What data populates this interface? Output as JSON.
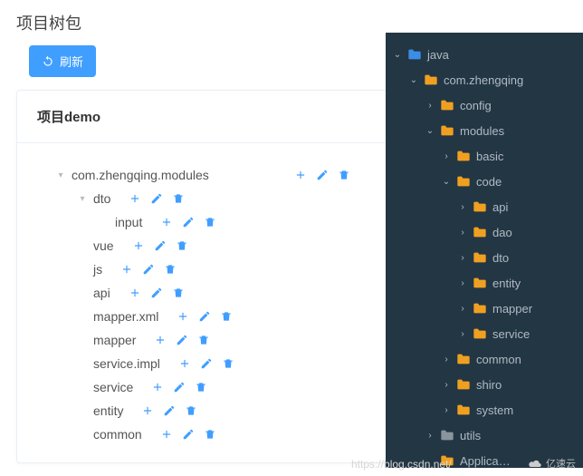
{
  "header": {
    "title": "项目树包",
    "refresh_label": "刷新"
  },
  "card": {
    "title": "项目demo"
  },
  "left_tree": {
    "nodes": [
      {
        "label": "com.zhengqing.modules",
        "indent": 0,
        "expand": "down",
        "gap": 94
      },
      {
        "label": "dto",
        "indent": 24,
        "expand": "down",
        "gap": 20
      },
      {
        "label": "input",
        "indent": 48,
        "expand": "",
        "gap": 20
      },
      {
        "label": "vue",
        "indent": 24,
        "expand": "",
        "gap": 20
      },
      {
        "label": "js",
        "indent": 24,
        "expand": "",
        "gap": 20
      },
      {
        "label": "api",
        "indent": 24,
        "expand": "",
        "gap": 20
      },
      {
        "label": "mapper.xml",
        "indent": 24,
        "expand": "",
        "gap": 20
      },
      {
        "label": "mapper",
        "indent": 24,
        "expand": "",
        "gap": 20
      },
      {
        "label": "service.impl",
        "indent": 24,
        "expand": "",
        "gap": 20
      },
      {
        "label": "service",
        "indent": 24,
        "expand": "",
        "gap": 20
      },
      {
        "label": "entity",
        "indent": 24,
        "expand": "",
        "gap": 20
      },
      {
        "label": "common",
        "indent": 24,
        "expand": "",
        "gap": 20
      }
    ]
  },
  "sidebar": {
    "items": [
      {
        "label": "java",
        "indent": 8,
        "chevron": "down",
        "folder": "blue"
      },
      {
        "label": "com.zhengqing",
        "indent": 26,
        "chevron": "down",
        "folder": "orange"
      },
      {
        "label": "config",
        "indent": 44,
        "chevron": "right",
        "folder": "orange"
      },
      {
        "label": "modules",
        "indent": 44,
        "chevron": "down",
        "folder": "orange"
      },
      {
        "label": "basic",
        "indent": 62,
        "chevron": "right",
        "folder": "orange"
      },
      {
        "label": "code",
        "indent": 62,
        "chevron": "down",
        "folder": "orange"
      },
      {
        "label": "api",
        "indent": 80,
        "chevron": "right",
        "folder": "orange"
      },
      {
        "label": "dao",
        "indent": 80,
        "chevron": "right",
        "folder": "orange"
      },
      {
        "label": "dto",
        "indent": 80,
        "chevron": "right",
        "folder": "orange"
      },
      {
        "label": "entity",
        "indent": 80,
        "chevron": "right",
        "folder": "orange"
      },
      {
        "label": "mapper",
        "indent": 80,
        "chevron": "right",
        "folder": "orange"
      },
      {
        "label": "service",
        "indent": 80,
        "chevron": "right",
        "folder": "orange"
      },
      {
        "label": "common",
        "indent": 62,
        "chevron": "right",
        "folder": "orange"
      },
      {
        "label": "shiro",
        "indent": 62,
        "chevron": "right",
        "folder": "orange"
      },
      {
        "label": "system",
        "indent": 62,
        "chevron": "right",
        "folder": "orange"
      },
      {
        "label": "utils",
        "indent": 44,
        "chevron": "right",
        "folder": "grey"
      },
      {
        "label": "Applica…",
        "indent": 44,
        "chevron": "",
        "folder": "orange"
      }
    ]
  },
  "watermark": {
    "url": "https://blog.csdn.net/",
    "brand": "亿速云"
  }
}
